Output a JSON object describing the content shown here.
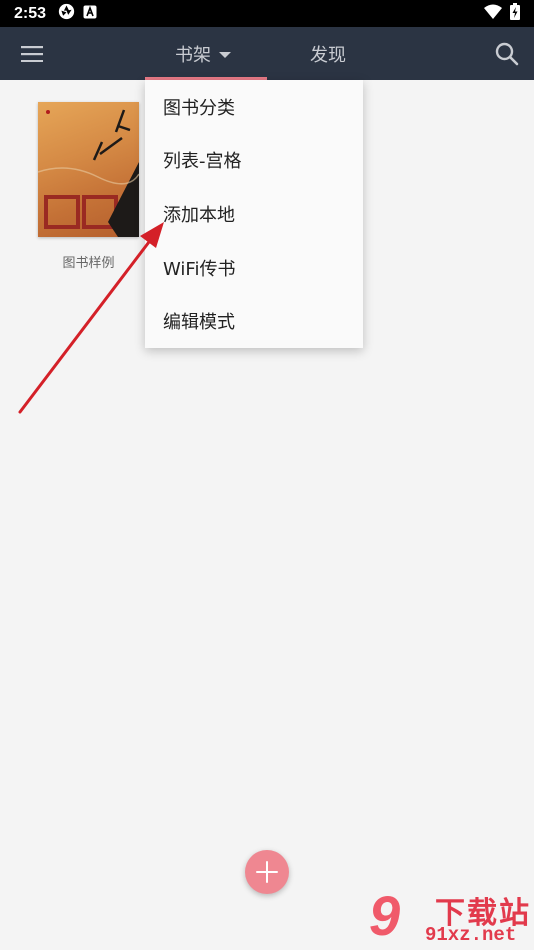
{
  "status_bar": {
    "time": "2:53",
    "left_icons": [
      "aperture-icon",
      "app-a-icon"
    ],
    "right_icons": [
      "wifi-icon",
      "battery-charging-icon"
    ]
  },
  "app_bar": {
    "menu_icon": "hamburger-menu-icon",
    "tabs": [
      {
        "label": "书架",
        "active": true,
        "has_dropdown": true
      },
      {
        "label": "发现",
        "active": false
      }
    ],
    "search_icon": "search-icon",
    "colors": {
      "background": "#2b3443",
      "accent": "#e77a86"
    }
  },
  "bookshelf": {
    "books": [
      {
        "title": "图书样例"
      }
    ]
  },
  "dropdown_menu": {
    "items": [
      {
        "label": "图书分类"
      },
      {
        "label": "列表-宫格"
      },
      {
        "label": "添加本地"
      },
      {
        "label": "WiFi传书"
      },
      {
        "label": "编辑模式"
      }
    ]
  },
  "fab": {
    "icon": "plus-icon",
    "color": "#ef8791"
  },
  "annotation": {
    "type": "arrow",
    "color": "#d42028",
    "points_to": "添加本地"
  },
  "watermark": {
    "glyph": "9",
    "text": "下载站",
    "url": "91xz.net"
  }
}
